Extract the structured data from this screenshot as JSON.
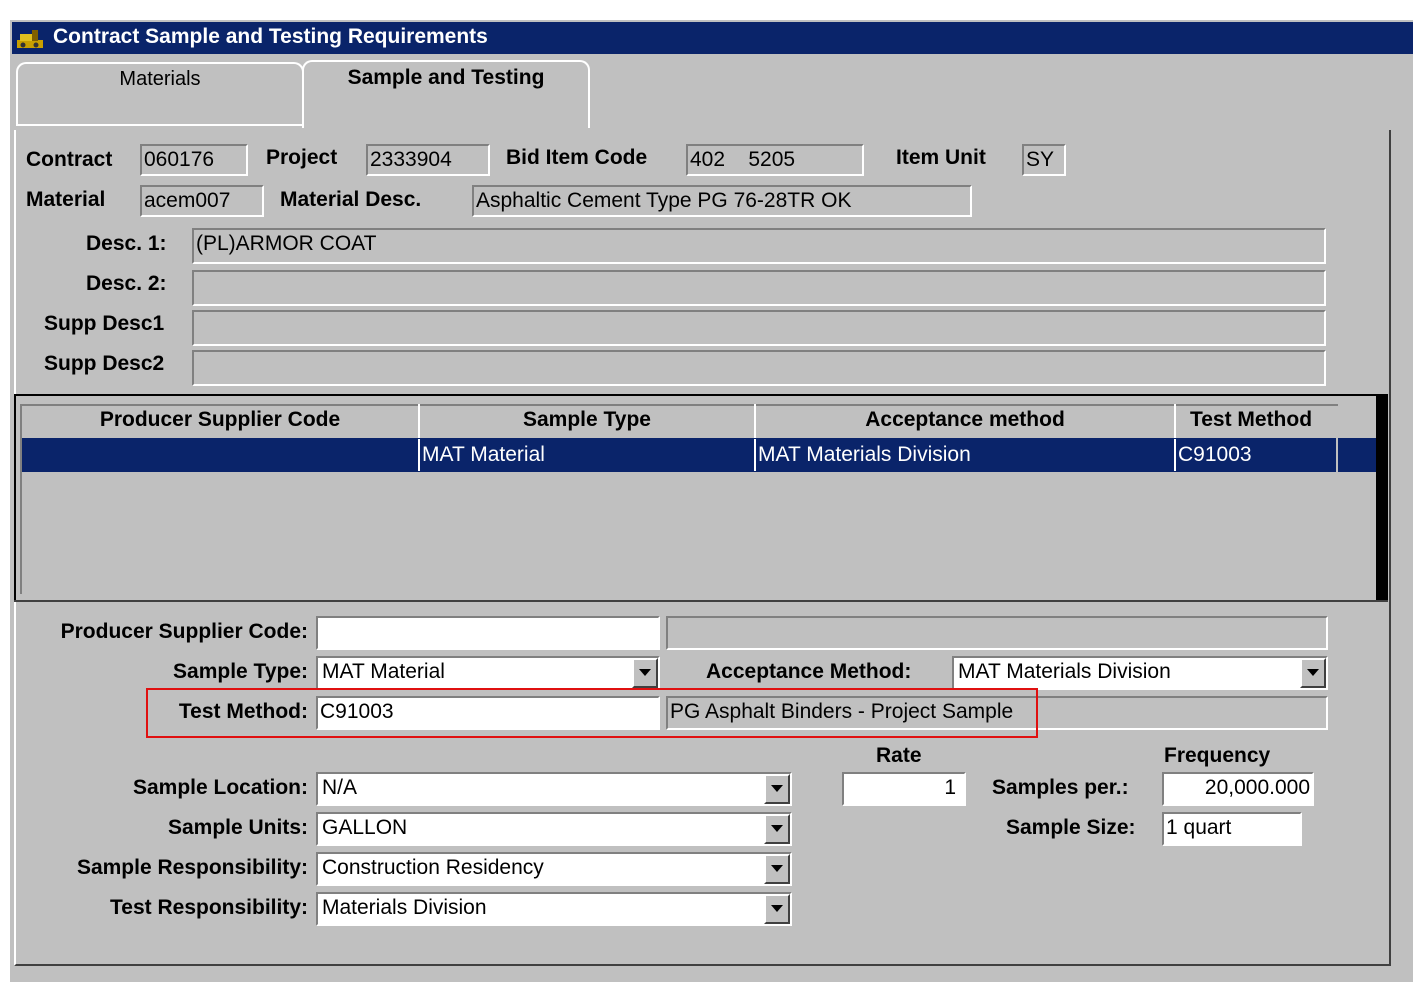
{
  "window": {
    "title": "Contract Sample and Testing Requirements"
  },
  "tabs": [
    {
      "label": "Materials",
      "active": false
    },
    {
      "label": "Sample and Testing",
      "active": true
    }
  ],
  "header": {
    "contract_label": "Contract",
    "contract": "060176",
    "project_label": "Project",
    "project": "2333904",
    "bid_item_label": "Bid Item Code",
    "bid_item": "402    5205",
    "item_unit_label": "Item Unit",
    "item_unit": "SY",
    "material_label": "Material",
    "material": "acem007",
    "material_desc_label": "Material Desc.",
    "material_desc": "Asphaltic Cement Type PG 76-28TR OK",
    "desc1_label": "Desc. 1:",
    "desc1": "(PL)ARMOR COAT",
    "desc2_label": "Desc. 2:",
    "desc2": "",
    "supp1_label": "Supp Desc1",
    "supp1": "",
    "supp2_label": "Supp Desc2",
    "supp2": ""
  },
  "grid": {
    "columns": [
      "Producer Supplier Code",
      "Sample Type",
      "Acceptance method",
      "Test Method"
    ],
    "rows": [
      {
        "producer": "",
        "sample_type": "MAT Material",
        "acceptance": "MAT Materials Division",
        "test_method": "C91003"
      }
    ]
  },
  "detail": {
    "producer_label": "Producer Supplier Code:",
    "producer": "",
    "producer_desc": "",
    "sample_type_label": "Sample Type:",
    "sample_type": "MAT Material",
    "acceptance_label": "Acceptance Method:",
    "acceptance": "MAT Materials Division",
    "test_method_label": "Test Method:",
    "test_method": "C91003",
    "test_method_desc": "PG Asphalt Binders - Project Sample",
    "rate_label": "Rate",
    "rate": "1",
    "frequency_label": "Frequency",
    "samples_per_label": "Samples per.:",
    "samples_per": "20,000.000",
    "sample_size_label": "Sample Size:",
    "sample_size": "1 quart",
    "sample_location_label": "Sample Location:",
    "sample_location": "N/A",
    "sample_units_label": "Sample Units:",
    "sample_units": "GALLON",
    "sample_resp_label": "Sample Responsibility:",
    "sample_resp": "Construction Residency",
    "test_resp_label": "Test Responsibility:",
    "test_resp": "Materials Division"
  },
  "colors": {
    "title_bar": "#0a246a",
    "selection": "#0a246a",
    "face": "#c0c0c0",
    "highlight_box": "#e01010"
  }
}
